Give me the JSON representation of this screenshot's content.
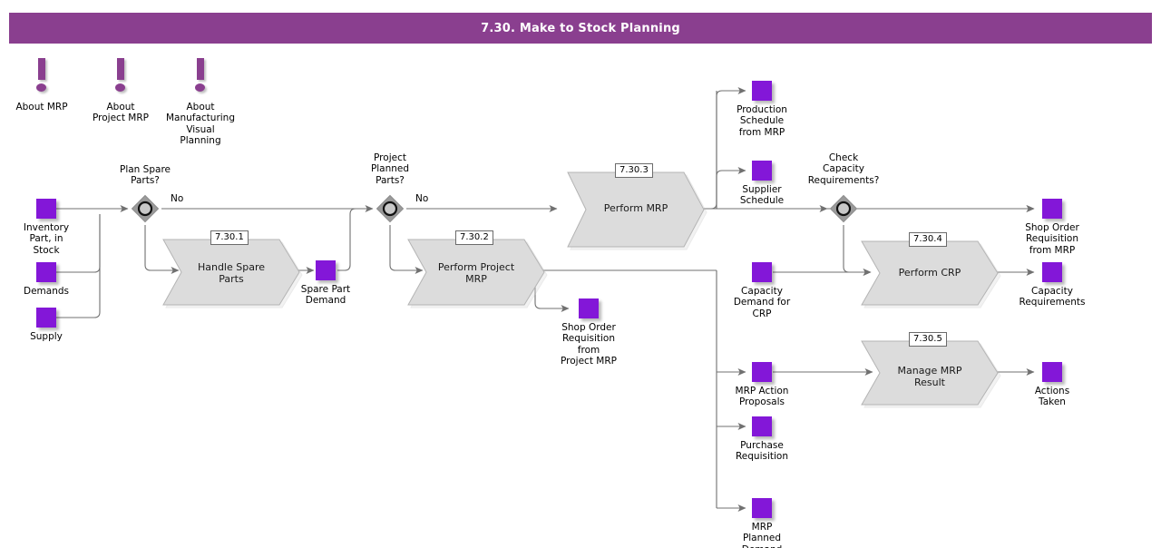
{
  "header": {
    "title": "7.30. Make to Stock Planning",
    "bar_color": "#8a3f8f",
    "text_color": "#ffffff"
  },
  "colors": {
    "data_square": "#8317d8",
    "process_fill": "#dcdcdc",
    "process_stroke": "#9a9a9a",
    "decision_fill": "#9a9a9a",
    "connector": "#707070",
    "info_marker": "#8a3f8f"
  },
  "info_markers": [
    {
      "id": "about-mrp",
      "label": "About MRP"
    },
    {
      "id": "about-project-mrp",
      "label": "About\nProject MRP"
    },
    {
      "id": "about-manufacturing-visual-planning",
      "label": "About\nManufacturing\nVisual\nPlanning"
    }
  ],
  "inputs": [
    {
      "id": "inventory-part-in-stock",
      "label": "Inventory\nPart, in\nStock"
    },
    {
      "id": "demands",
      "label": "Demands"
    },
    {
      "id": "supply",
      "label": "Supply"
    }
  ],
  "decisions": [
    {
      "id": "plan-spare-parts",
      "label": "Plan Spare\nParts?",
      "branch_label": "No"
    },
    {
      "id": "project-planned-parts",
      "label": "Project\nPlanned\nParts?",
      "branch_label": "No"
    },
    {
      "id": "check-capacity-requirements",
      "label": "Check\nCapacity\nRequirements?",
      "branch_label": ""
    }
  ],
  "processes": [
    {
      "id": "handle-spare-parts",
      "number": "7.30.1",
      "label": "Handle Spare\nParts"
    },
    {
      "id": "perform-project-mrp",
      "number": "7.30.2",
      "label": "Perform Project\nMRP"
    },
    {
      "id": "perform-mrp",
      "number": "7.30.3",
      "label": "Perform MRP"
    },
    {
      "id": "perform-crp",
      "number": "7.30.4",
      "label": "Perform CRP"
    },
    {
      "id": "manage-mrp-result",
      "number": "7.30.5",
      "label": "Manage MRP\nResult"
    }
  ],
  "artifacts": [
    {
      "id": "spare-part-demand",
      "label": "Spare Part\nDemand"
    },
    {
      "id": "shop-order-requisition-from-project-mrp",
      "label": "Shop Order\nRequisition\nfrom\nProject MRP"
    },
    {
      "id": "production-schedule-from-mrp",
      "label": "Production\nSchedule\nfrom MRP"
    },
    {
      "id": "supplier-schedule",
      "label": "Supplier\nSchedule"
    },
    {
      "id": "capacity-demand-for-crp",
      "label": "Capacity\nDemand for\nCRP"
    },
    {
      "id": "mrp-action-proposals",
      "label": "MRP Action\nProposals"
    },
    {
      "id": "purchase-requisition",
      "label": "Purchase\nRequisition"
    },
    {
      "id": "mrp-planned-demand",
      "label": "MRP\nPlanned\nDemand"
    },
    {
      "id": "shop-order-requisition-from-mrp",
      "label": "Shop Order\nRequisition\nfrom MRP"
    },
    {
      "id": "capacity-requirements",
      "label": "Capacity\nRequirements"
    },
    {
      "id": "actions-taken",
      "label": "Actions\nTaken"
    }
  ]
}
